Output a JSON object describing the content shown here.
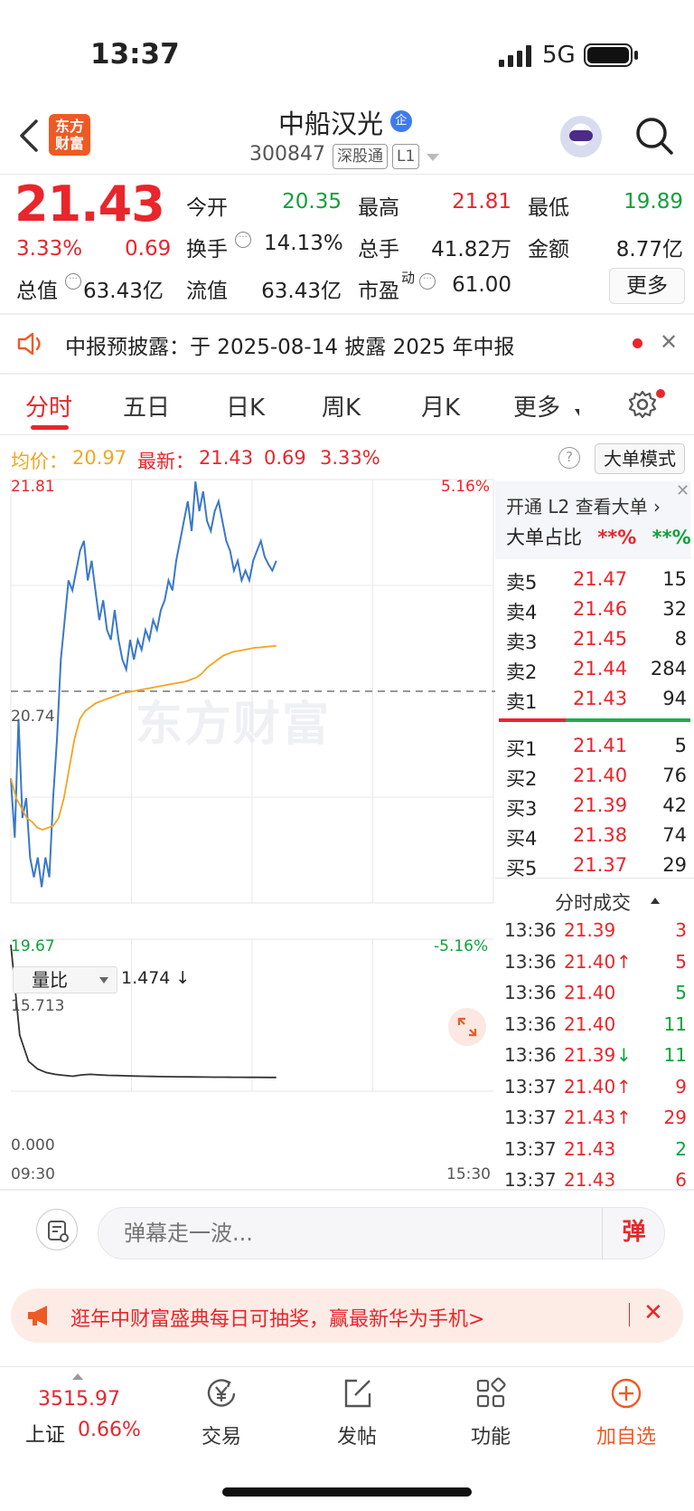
{
  "status_bar": {
    "time": "13:37",
    "network": "5G"
  },
  "header": {
    "logo": "东方财富",
    "stock_name": "中船汉光",
    "badge": "企",
    "code": "300847",
    "tags": [
      "深股通",
      "L1"
    ]
  },
  "quote": {
    "price": "21.43",
    "change_pct": "3.33%",
    "change": "0.69",
    "fields": [
      {
        "label": "今开",
        "value": "20.35",
        "color": "#10a23a"
      },
      {
        "label": "最高",
        "value": "21.81",
        "color": "#e8262c"
      },
      {
        "label": "最低",
        "value": "19.89",
        "color": "#10a23a"
      },
      {
        "label": "换手",
        "value": "14.13%",
        "color": "#222"
      },
      {
        "label": "总手",
        "value": "41.82万",
        "color": "#222"
      },
      {
        "label": "金额",
        "value": "8.77亿",
        "color": "#222"
      },
      {
        "label": "总值",
        "value": "63.43亿",
        "color": "#222"
      },
      {
        "label": "流值",
        "value": "63.43亿",
        "color": "#222"
      },
      {
        "label": "市盈",
        "value": "61.00",
        "color": "#222"
      }
    ],
    "pe_super": "动",
    "more_label": "更多"
  },
  "notice": {
    "text": "中报预披露：于 2025-08-14 披露 2025 年中报"
  },
  "tabs": [
    "分时",
    "五日",
    "日K",
    "周K",
    "月K",
    "更多"
  ],
  "summary": {
    "avg_label": "均价：",
    "avg_value": "20.97",
    "latest_label": "最新：",
    "latest_price": "21.43",
    "latest_change": "0.69",
    "latest_pct": "3.33%",
    "big_order_mode": "大单模式"
  },
  "chart_data": {
    "type": "line",
    "y_high": "21.81",
    "y_prev_close": "20.74",
    "y_low": "19.67",
    "pct_high": "5.16%",
    "pct_low": "-5.16%",
    "ylim": [
      19.67,
      21.81
    ],
    "prev_close": 20.74,
    "x_start": "09:30",
    "x_end": "15:30",
    "watermark": "东方财富",
    "series": [
      {
        "role": "price",
        "color": "#3a78c8",
        "values": [
          20.3,
          20.0,
          20.6,
          20.1,
          20.2,
          19.9,
          19.8,
          19.9,
          19.75,
          19.9,
          19.8,
          20.2,
          20.5,
          20.9,
          21.1,
          21.3,
          21.25,
          21.35,
          21.45,
          21.5,
          21.3,
          21.4,
          21.25,
          21.1,
          21.2,
          21.05,
          21.0,
          21.15,
          21.0,
          20.9,
          20.85,
          21.0,
          20.9,
          21.0,
          20.95,
          21.05,
          21.0,
          21.1,
          21.05,
          21.15,
          21.2,
          21.3,
          21.25,
          21.4,
          21.5,
          21.6,
          21.7,
          21.55,
          21.8,
          21.65,
          21.75,
          21.6,
          21.55,
          21.65,
          21.7,
          21.6,
          21.5,
          21.45,
          21.35,
          21.4,
          21.3,
          21.35,
          21.3,
          21.4,
          21.45,
          21.5,
          21.42,
          21.38,
          21.35,
          21.4
        ]
      },
      {
        "role": "average",
        "color": "#f3a522",
        "values": [
          20.3,
          20.2,
          20.15,
          20.1,
          20.08,
          20.05,
          20.04,
          20.05,
          20.06,
          20.1,
          20.2,
          20.35,
          20.5,
          20.6,
          20.64,
          20.66,
          20.68,
          20.69,
          20.7,
          20.71,
          20.72,
          20.73,
          20.735,
          20.74,
          20.745,
          20.75,
          20.755,
          20.76,
          20.765,
          20.77,
          20.775,
          20.78,
          20.785,
          20.79,
          20.8,
          20.81,
          20.83,
          20.86,
          20.88,
          20.9,
          20.92,
          20.93,
          20.94,
          20.945,
          20.95,
          20.955,
          20.96,
          20.962,
          20.965,
          20.967,
          20.97
        ]
      }
    ],
    "volume_ratio": {
      "label": "量比",
      "current": "1.474 ↓",
      "y_max": "15.713",
      "y_min": "0.000",
      "values": [
        15.7,
        6.0,
        3.2,
        2.4,
        2.0,
        1.8,
        1.7,
        1.6,
        1.75,
        1.8,
        1.75,
        1.7,
        1.68,
        1.65,
        1.62,
        1.6,
        1.58,
        1.56,
        1.55,
        1.54,
        1.53,
        1.52,
        1.51,
        1.5,
        1.5,
        1.49,
        1.49,
        1.48,
        1.48,
        1.47,
        1.474
      ]
    }
  },
  "order_book": {
    "open_l2": "开通 L2 查看大单",
    "big_ratio_label": "大单占比",
    "big_ratio_red": "**%",
    "big_ratio_green": "**%",
    "asks": [
      {
        "label": "卖5",
        "price": "21.47",
        "vol": "15"
      },
      {
        "label": "卖4",
        "price": "21.46",
        "vol": "32"
      },
      {
        "label": "卖3",
        "price": "21.45",
        "vol": "8"
      },
      {
        "label": "卖2",
        "price": "21.44",
        "vol": "284"
      },
      {
        "label": "卖1",
        "price": "21.43",
        "vol": "94"
      }
    ],
    "bids": [
      {
        "label": "买1",
        "price": "21.41",
        "vol": "5"
      },
      {
        "label": "买2",
        "price": "21.40",
        "vol": "76"
      },
      {
        "label": "买3",
        "price": "21.39",
        "vol": "42"
      },
      {
        "label": "买4",
        "price": "21.38",
        "vol": "74"
      },
      {
        "label": "买5",
        "price": "21.37",
        "vol": "29"
      }
    ],
    "ticks_title": "分时成交",
    "ticks": [
      {
        "time": "13:36",
        "price": "21.39",
        "dir": "",
        "vol": "3",
        "vol_color": "#e8262c"
      },
      {
        "time": "13:36",
        "price": "21.40",
        "dir": "↑",
        "vol": "5",
        "vol_color": "#e8262c"
      },
      {
        "time": "13:36",
        "price": "21.40",
        "dir": "",
        "vol": "5",
        "vol_color": "#10a23a"
      },
      {
        "time": "13:36",
        "price": "21.40",
        "dir": "",
        "vol": "11",
        "vol_color": "#10a23a"
      },
      {
        "time": "13:36",
        "price": "21.39",
        "dir": "↓",
        "vol": "11",
        "vol_color": "#10a23a"
      },
      {
        "time": "13:37",
        "price": "21.40",
        "dir": "↑",
        "vol": "9",
        "vol_color": "#e8262c"
      },
      {
        "time": "13:37",
        "price": "21.43",
        "dir": "↑",
        "vol": "29",
        "vol_color": "#e8262c"
      },
      {
        "time": "13:37",
        "price": "21.43",
        "dir": "",
        "vol": "2",
        "vol_color": "#10a23a"
      },
      {
        "time": "13:37",
        "price": "21.43",
        "dir": "",
        "vol": "6",
        "vol_color": "#e8262c"
      }
    ]
  },
  "comment_bar": {
    "placeholder": "弹幕走一波...",
    "button": "弹"
  },
  "promo": {
    "text": "逛年中财富盛典每日可抽奖，赢最新华为手机>"
  },
  "bottom_nav": {
    "index_value": "3515.97",
    "index_label": "上证",
    "index_pct": "0.66%",
    "items": [
      {
        "label": "交易",
        "icon": "trade-yen-icon"
      },
      {
        "label": "发帖",
        "icon": "compose-icon"
      },
      {
        "label": "功能",
        "icon": "grid-icon"
      },
      {
        "label": "加自选",
        "icon": "add-circle-icon"
      }
    ]
  }
}
